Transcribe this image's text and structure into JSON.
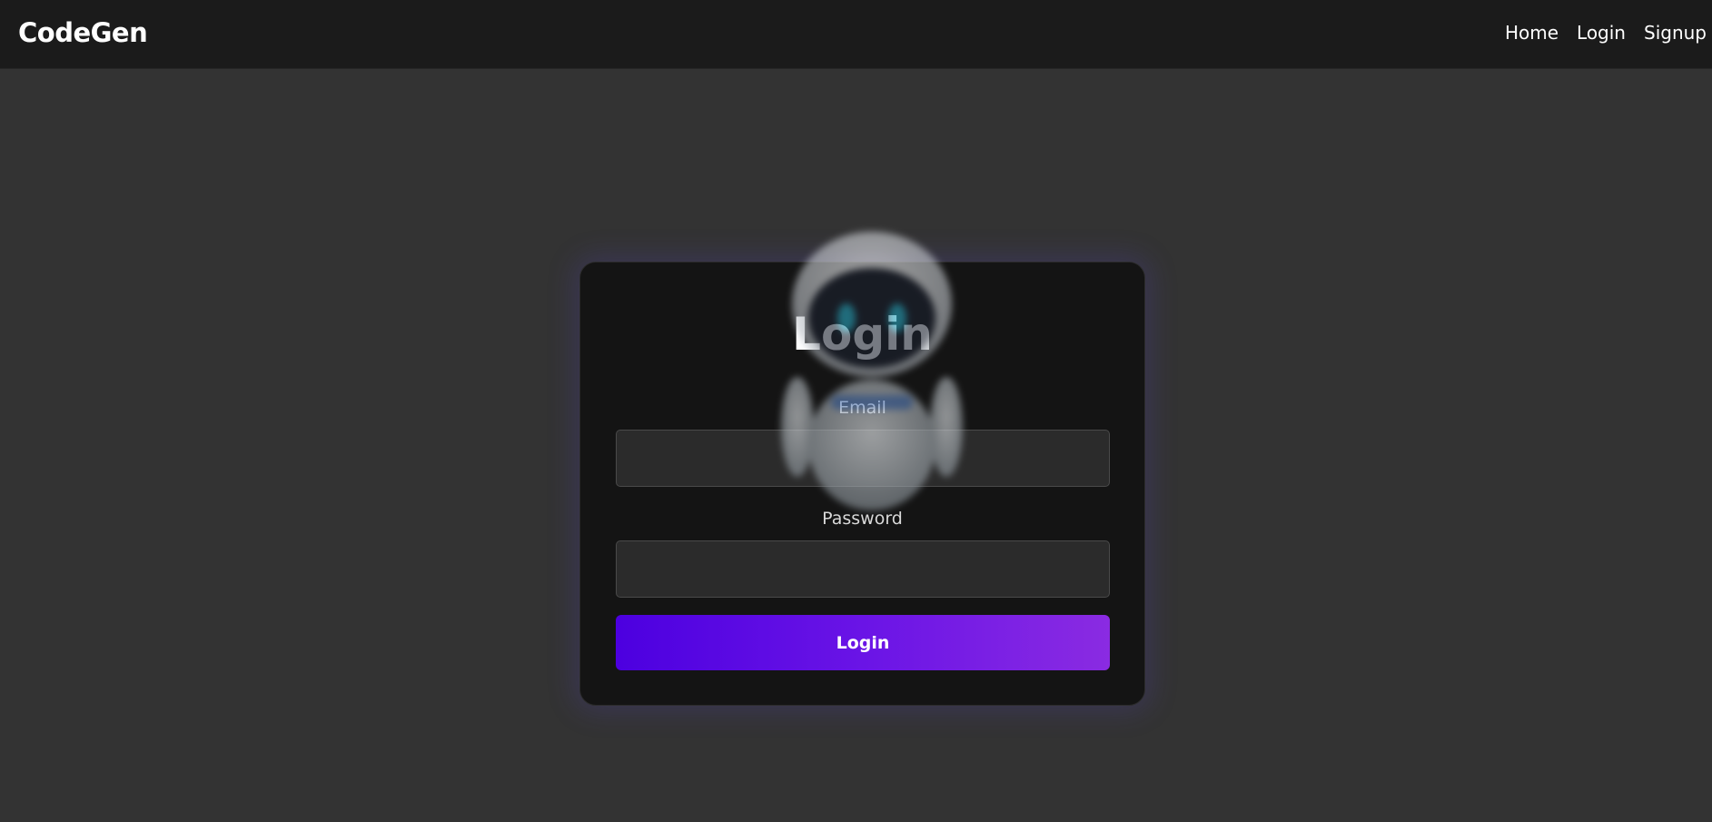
{
  "navbar": {
    "brand": "CodeGen",
    "links": [
      {
        "label": "Home"
      },
      {
        "label": "Login"
      },
      {
        "label": "Signup"
      }
    ]
  },
  "login_card": {
    "title": "Login",
    "email": {
      "label": "Email",
      "value": "",
      "placeholder": ""
    },
    "password": {
      "label": "Password",
      "value": "",
      "placeholder": ""
    },
    "submit_label": "Login"
  },
  "colors": {
    "background": "#333333",
    "navbar": "#1b1b1b",
    "card": "#141414",
    "button_gradient_start": "#4c00e0",
    "button_gradient_end": "#8a2be2"
  },
  "icons": {
    "mascot": "robot-mascot-icon"
  }
}
